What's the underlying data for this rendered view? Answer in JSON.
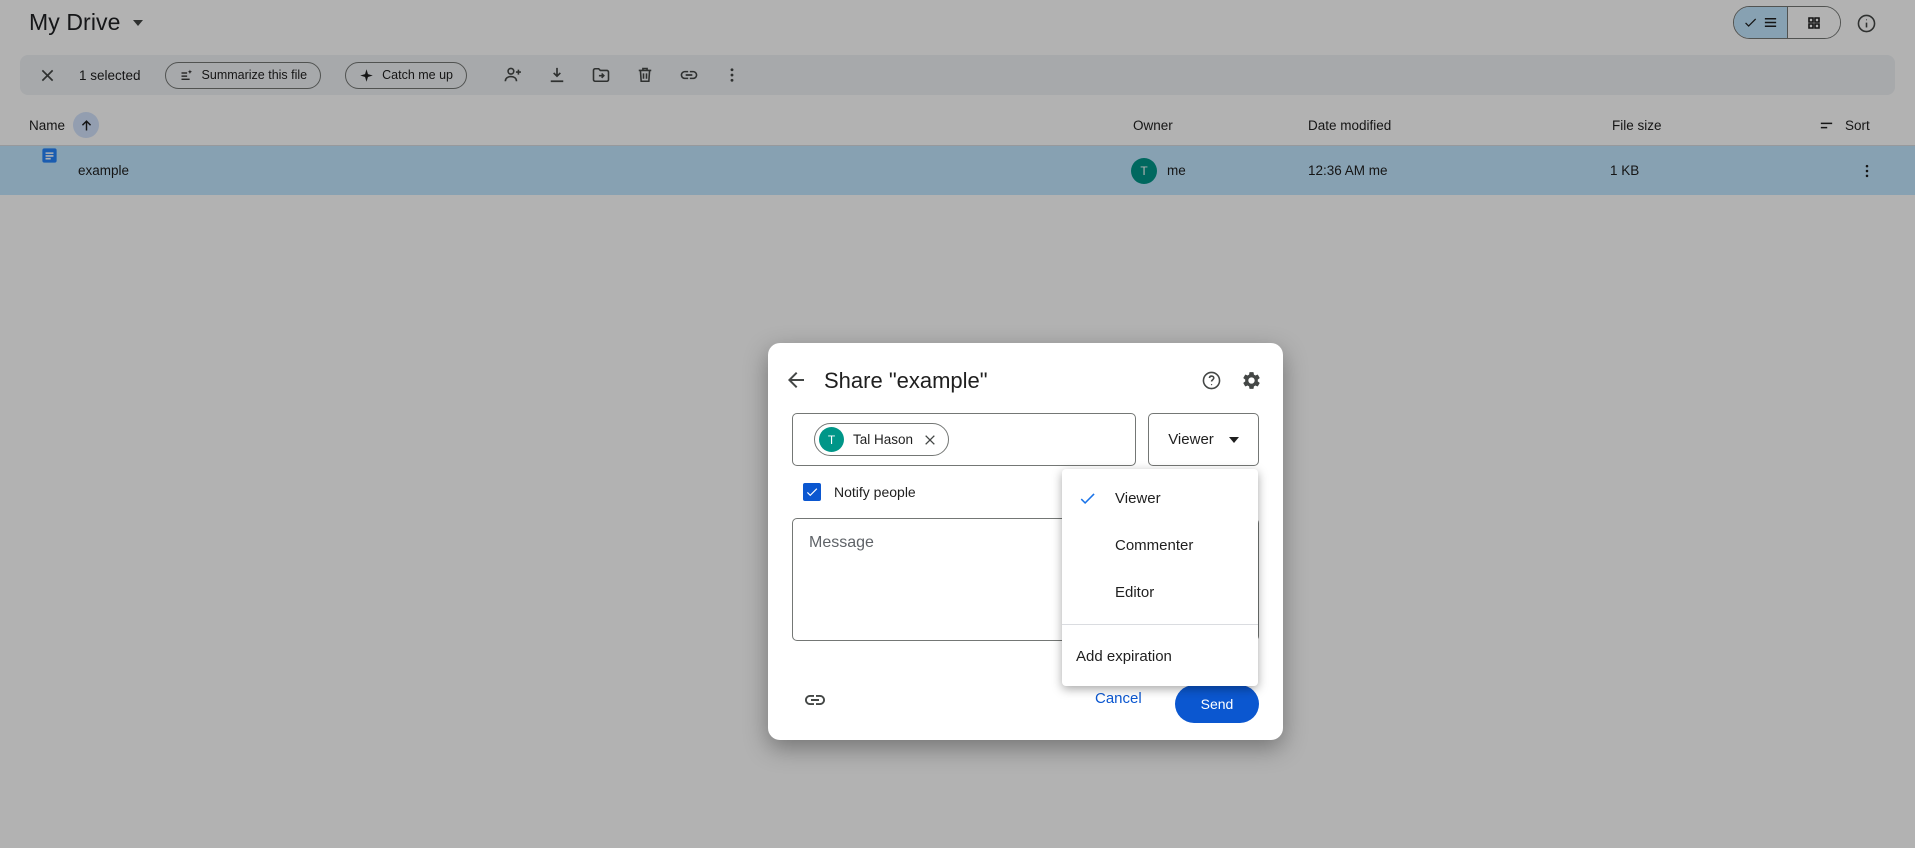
{
  "header": {
    "title": "My Drive"
  },
  "view_controls": {
    "list_view_icon": "check-and-list-lines",
    "grid_view_icon": "grid-squares",
    "info_icon": "info-circle"
  },
  "toolbar": {
    "selected_count": "1 selected",
    "summarize_label": "Summarize this file",
    "catch_up_label": "Catch me up",
    "icons": [
      "close-icon",
      "summarize-icon",
      "sparkle-icon",
      "person-add-icon",
      "download-icon",
      "move-folder-icon",
      "trash-icon",
      "link-icon",
      "more-vertical-icon"
    ]
  },
  "table": {
    "headers": {
      "name": "Name",
      "owner": "Owner",
      "modified": "Date modified",
      "size": "File size",
      "sort": "Sort"
    },
    "sort_direction": "ascending",
    "rows": [
      {
        "name": "example",
        "file_type": "google-doc",
        "owner": "me",
        "owner_initial": "T",
        "modified": "12:36 AM me",
        "size": "1 KB"
      }
    ]
  },
  "dialog": {
    "title": "Share \"example\"",
    "recipient_chip": {
      "initial": "T",
      "name": "Tal Hason"
    },
    "role_button_label": "Viewer",
    "notify_label": "Notify people",
    "message_placeholder": "Message",
    "cancel_label": "Cancel",
    "send_label": "Send",
    "notify_checked": "true"
  },
  "role_menu": {
    "items": [
      {
        "label": "Viewer",
        "checked": true
      },
      {
        "label": "Commenter",
        "checked": false
      },
      {
        "label": "Editor",
        "checked": false
      }
    ],
    "expiration_label": "Add expiration"
  },
  "colors": {
    "accent_blue": "#0b57d0",
    "check_blue": "#1a73e8",
    "selected_row": "#c2e7ff",
    "avatar_teal": "#009688",
    "toolbar_bg": "#eff2f5",
    "doc_icon_blue": "#2684fc",
    "scrim": "rgba(0,0,0,0.30)"
  }
}
